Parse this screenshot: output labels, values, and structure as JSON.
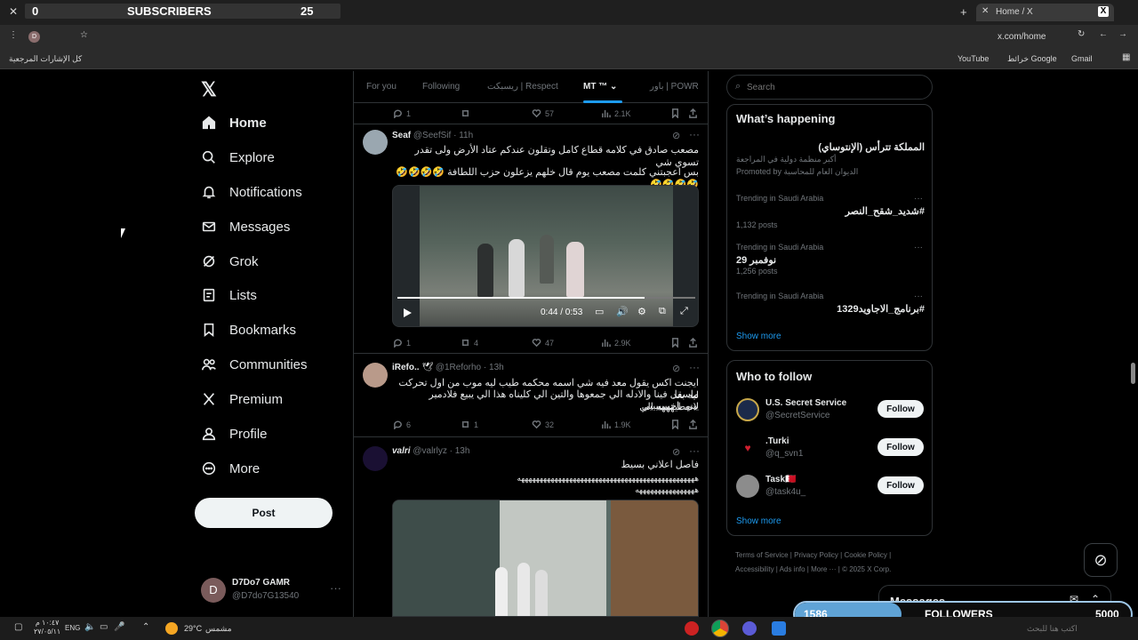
{
  "browser": {
    "tab_title": "Home / X",
    "url": "x.com/home",
    "bookmarks_folder": "كل الإشارات المرجعية",
    "bookmarks": [
      "YouTube",
      "خرائط Google",
      "Gmail"
    ]
  },
  "overlay": {
    "subscribers_label": "SUBSCRIBERS",
    "subscribers_left": "0",
    "subscribers_count": "25",
    "followers_current": "1586",
    "followers_label": "FOLLOWERS",
    "followers_goal": "5000",
    "followers_progress": 0.3172
  },
  "nav": {
    "items": [
      {
        "label": "Home",
        "icon": "home-icon"
      },
      {
        "label": "Explore",
        "icon": "search-icon"
      },
      {
        "label": "Notifications",
        "icon": "bell-icon"
      },
      {
        "label": "Messages",
        "icon": "envelope-icon"
      },
      {
        "label": "Grok",
        "icon": "grok-icon"
      },
      {
        "label": "Lists",
        "icon": "list-icon"
      },
      {
        "label": "Bookmarks",
        "icon": "bookmark-icon"
      },
      {
        "label": "Communities",
        "icon": "people-icon"
      },
      {
        "label": "Premium",
        "icon": "x-logo-icon"
      },
      {
        "label": "Profile",
        "icon": "person-icon"
      },
      {
        "label": "More",
        "icon": "more-circle-icon"
      }
    ],
    "post_button": "Post",
    "account": {
      "initial": "D",
      "name": "D7Do7 GAMR",
      "handle": "@D7do7G13540"
    }
  },
  "tabs": [
    "For you",
    "Following",
    "ريسبكت | Respect",
    "MT ™",
    "باور | POWR"
  ],
  "first_stats": {
    "replies": "1",
    "likes": "57",
    "views": "2.1K"
  },
  "tweets": [
    {
      "name": "Seaf",
      "handle": "@SeefSif",
      "time": "· 11h",
      "text1": "مصعب صادق في كلامه قطاع كامل وتقلون عندكم عتاد الأرض ولى تقدر تسوي شي",
      "text2": "بس اعجبتني كلمت مصعب يوم قال خلهم يزعلون حزب اللطافة 🤣🤣🤣🤣🤣🤣🤣🤣",
      "video_time": "0:44 / 0:53",
      "video_progress": 0.83,
      "replies": "1",
      "reposts": "4",
      "likes": "47",
      "views": "2.9K"
    },
    {
      "name": "iRefo..",
      "handle": "@1Reforho",
      "time": "· 13h",
      "text1": "ايجنت اكس يقول معد فيه شي اسمه محكمه طيب ليه موب من اول تحركت ليه بعد",
      "text2": "ماسقل فينا والادله الي جمعوها والتين الي كليناه هذا الي يبيع فلادمير لاتعطيهههه الي",
      "text3": "يبي باخيييييييي",
      "replies": "6",
      "reposts": "1",
      "likes": "32",
      "views": "1.9K"
    },
    {
      "name": "valri",
      "handle": "@valrlyz",
      "time": "· 13h",
      "text1": "فاصل اعلاني بسيط",
      "text2": "ههههههههههههههههههههههههههههههههههههههههههههههههه",
      "text3": "ههههههههههههههههه"
    }
  ],
  "search": {
    "placeholder": "Search"
  },
  "whats_happening": {
    "title": "What’s happening",
    "promo": {
      "title": "المملكة تترأس (الإنتوساي)",
      "sub": "أكبر منظمة دولية في المراجعة",
      "promoted": "Promoted by الديوان العام للمحاسبة"
    },
    "trends": [
      {
        "meta": "Trending in Saudi Arabia",
        "title": "#شديد_شقح_النصر",
        "posts": "1,132 posts"
      },
      {
        "meta": "Trending in Saudi Arabia",
        "title": "نوفمبر 29",
        "posts": "1,256 posts"
      },
      {
        "meta": "Trending in Saudi Arabia",
        "title": "#برنامج_الاجاويد1329",
        "posts": ""
      }
    ],
    "show_more": "Show more"
  },
  "who_to_follow": {
    "title": "Who to follow",
    "users": [
      {
        "name": "U.S. Secret Service",
        "handle": "@SecretService",
        "button": "Follow"
      },
      {
        "name": ".Turki",
        "handle": "@q_svn1",
        "button": "Follow"
      },
      {
        "name": "Task🇧🇭",
        "handle": "@task4u_",
        "button": "Follow"
      }
    ],
    "show_more": "Show more"
  },
  "footer": {
    "links": [
      "Terms of Service",
      "Privacy Policy",
      "Cookie Policy",
      "Accessibility",
      "Ads info",
      "More ···",
      "© 2025 X Corp."
    ]
  },
  "messages_drawer": {
    "title": "Messages"
  },
  "taskbar": {
    "time": "١٠:٤٧ م",
    "date": "٢٧/٠٥/١١",
    "lang": "ENG",
    "weather_temp": "29°C",
    "weather_label": "مشمس",
    "search_placeholder": "اكتب هنا للبحث"
  }
}
